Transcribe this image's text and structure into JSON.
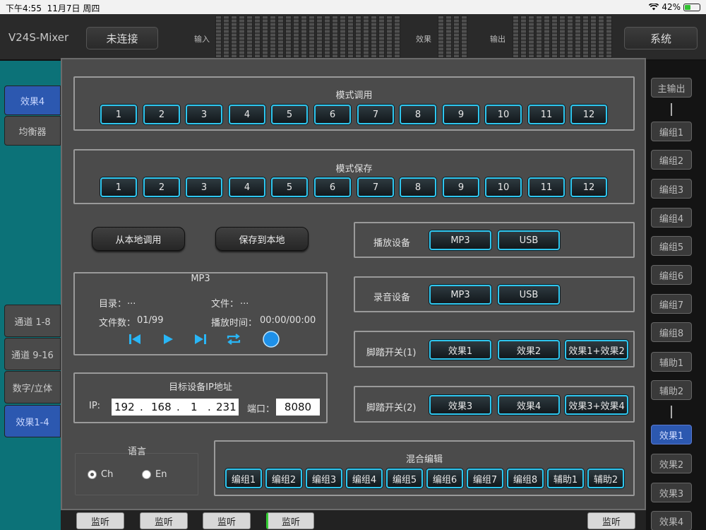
{
  "status": {
    "time": "下午4:55",
    "date": "11月7日 周四",
    "battery": "42%"
  },
  "app": {
    "title": "V24S-Mixer",
    "connect_label": "未连接",
    "system_label": "系统",
    "input_label": "输入",
    "effect_label": "效果",
    "output_label": "输出"
  },
  "left_nav": {
    "items": [
      "效果4",
      "均衡器",
      "通道 1-8",
      "通道 9-16",
      "数字/立体",
      "效果1-4"
    ]
  },
  "right_nav": {
    "items": [
      "主输出",
      "编组1",
      "编组2",
      "编组3",
      "编组4",
      "编组5",
      "编组6",
      "编组7",
      "编组8",
      "辅助1",
      "辅助2",
      "效果1",
      "效果2",
      "效果3",
      "效果4"
    ]
  },
  "bottom": {
    "monitor_label": "监听"
  },
  "dialog": {
    "mode_recall": {
      "title": "模式调用",
      "buttons": [
        "1",
        "2",
        "3",
        "4",
        "5",
        "6",
        "7",
        "8",
        "9",
        "10",
        "11",
        "12"
      ]
    },
    "mode_save": {
      "title": "模式保存",
      "buttons": [
        "1",
        "2",
        "3",
        "4",
        "5",
        "6",
        "7",
        "8",
        "9",
        "10",
        "11",
        "12"
      ]
    },
    "load_local": "从本地调用",
    "save_local": "保存到本地",
    "mp3": {
      "title": "MP3",
      "dir_label": "目录：",
      "dir_value": "...",
      "file_label": "文件：",
      "file_value": "...",
      "count_label": "文件数：",
      "count_value": "01/99",
      "time_label": "播放时间：",
      "time_value": "00:00/00:00"
    },
    "ip": {
      "title": "目标设备IP地址",
      "ip_label": "IP:",
      "ip1": "192",
      "ip2": "168",
      "ip3": "1",
      "ip4": "231",
      "dot": ".",
      "port_label": "端口：",
      "port": "8080"
    },
    "language": {
      "title": "语言",
      "opt1": "Ch",
      "opt2": "En"
    },
    "play_device": {
      "label": "播放设备",
      "opt1": "MP3",
      "opt2": "USB"
    },
    "record_device": {
      "label": "录音设备",
      "opt1": "MP3",
      "opt2": "USB"
    },
    "foot1": {
      "label": "脚踏开关(1)",
      "opt1": "效果1",
      "opt2": "效果2",
      "opt3": "效果1+效果2"
    },
    "foot2": {
      "label": "脚踏开关(2)",
      "opt1": "效果3",
      "opt2": "效果4",
      "opt3": "效果3+效果4"
    },
    "mix_edit": {
      "title": "混合编辑",
      "buttons": [
        "编组1",
        "编组2",
        "编组3",
        "编组4",
        "编组5",
        "编组6",
        "编组7",
        "编组8",
        "辅助1",
        "辅助2"
      ]
    }
  },
  "colors": {
    "accent": "#2fc6ee",
    "teal_panel": "#0c7278",
    "blue_selected": "#2c58b0"
  }
}
